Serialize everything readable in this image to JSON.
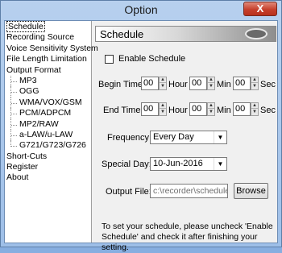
{
  "window": {
    "title": "Option",
    "close_label": "X"
  },
  "sidebar": {
    "items": [
      {
        "label": "Schedule",
        "sub": false,
        "selected": true
      },
      {
        "label": "Recording Source",
        "sub": false
      },
      {
        "label": "Voice Sensitivity System",
        "sub": false
      },
      {
        "label": "File Length Limitation",
        "sub": false
      },
      {
        "label": "Output Format",
        "sub": false
      },
      {
        "label": "MP3",
        "sub": true
      },
      {
        "label": "OGG",
        "sub": true
      },
      {
        "label": "WMA/VOX/GSM",
        "sub": true
      },
      {
        "label": "PCM/ADPCM",
        "sub": true
      },
      {
        "label": "MP2/RAW",
        "sub": true
      },
      {
        "label": "a-LAW/u-LAW",
        "sub": true
      },
      {
        "label": "G721/G723/G726",
        "sub": true
      },
      {
        "label": "Short-Cuts",
        "sub": false
      },
      {
        "label": "Register",
        "sub": false
      },
      {
        "label": "About",
        "sub": false
      }
    ]
  },
  "panel": {
    "title": "Schedule",
    "enable_schedule_label": "Enable Schedule",
    "enable_schedule_checked": false,
    "begin_time": {
      "label": "Begin Time:",
      "hour": "00",
      "min": "00",
      "sec": "00"
    },
    "end_time": {
      "label": "End Time:",
      "hour": "00",
      "min": "00",
      "sec": "00"
    },
    "units": {
      "hour": "Hour",
      "min": "Min",
      "sec": "Sec"
    },
    "frequency": {
      "label": "Frequency:",
      "value": "Every Day"
    },
    "special_day": {
      "label": "Special Day:",
      "value": "10-Jun-2016"
    },
    "output_file": {
      "label": "Output File:",
      "value": "c:\\recorder\\schedule\\",
      "browse_label": "Browse"
    },
    "note": "To set your schedule, please uncheck 'Enable Schedule' and check it after finishing your setting."
  }
}
